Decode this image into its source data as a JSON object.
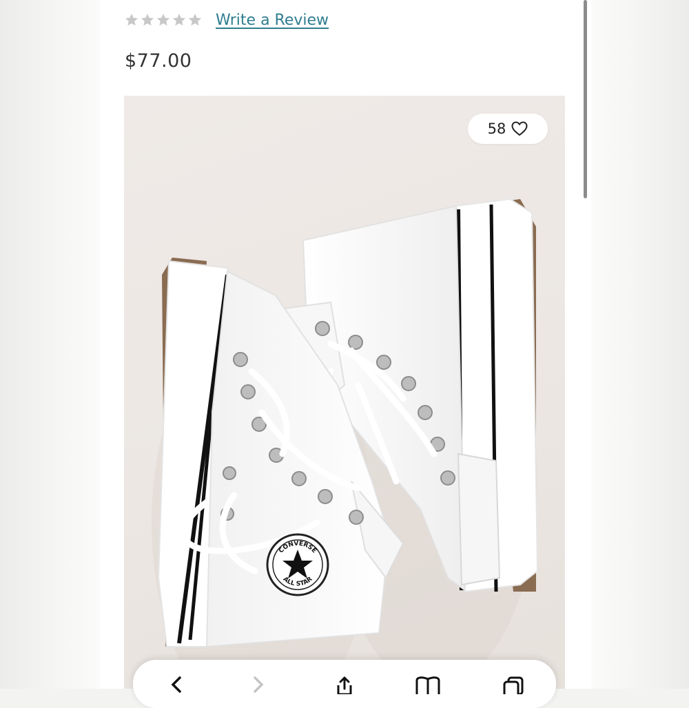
{
  "product": {
    "rating": {
      "stars_filled": 0,
      "stars_total": 5,
      "empty_star_color": "#c8c8c8"
    },
    "write_review_label": "Write a Review",
    "price": "$77.00"
  },
  "image": {
    "likes_count": "58",
    "like_icon": "heart-outline-icon",
    "logo_text_top": "CONVERSE",
    "logo_text_bottom": "ALL STAR"
  },
  "browser_toolbar": {
    "icons": [
      "back-chevron-icon",
      "forward-chevron-icon",
      "share-icon",
      "bookmarks-icon",
      "tabs-icon"
    ]
  },
  "colors": {
    "link": "#2f7d8f",
    "photo_background": "#ece7e3",
    "text": "#333333"
  }
}
